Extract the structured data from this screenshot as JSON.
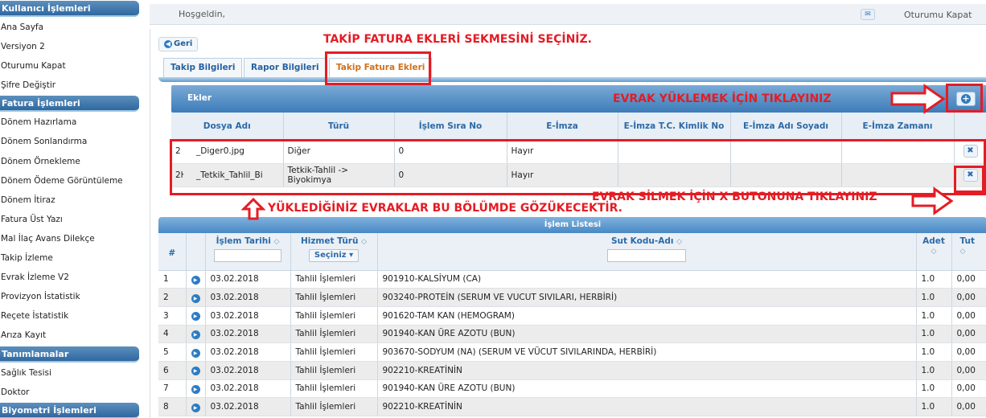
{
  "sidebar": {
    "sections": [
      {
        "title": "Kullanıcı İşlemleri",
        "items": [
          "Ana Sayfa",
          "Versiyon 2",
          "Oturumu Kapat",
          "Şifre Değiştir"
        ]
      },
      {
        "title": "Fatura İşlemleri",
        "items": [
          "Dönem Hazırlama",
          "Dönem Sonlandırma",
          "Dönem Örnekleme",
          "Dönem Ödeme Görüntüleme",
          "Dönem İtiraz",
          "Fatura Üst Yazı",
          "Mal İlaç Avans Dilekçe",
          "Takip İzleme",
          "Evrak İzleme V2",
          "Provizyon İstatistik",
          "Reçete İstatistik",
          "Arıza Kayıt"
        ]
      },
      {
        "title": "Tanımlamalar",
        "items": [
          "Sağlık Tesisi",
          "Doktor"
        ]
      },
      {
        "title": "Biyometri İşlemleri",
        "items": []
      }
    ]
  },
  "topbar": {
    "welcome": "Hoşgeldin,",
    "logout": "Oturumu Kapat",
    "mail_icon": "mail-icon"
  },
  "back_button": "Geri",
  "tabs": [
    "Takip Bilgileri",
    "Rapor Bilgileri",
    "Takip Fatura Ekleri"
  ],
  "attachments": {
    "title": "Ekler",
    "columns": [
      "Dosya Adı",
      "Türü",
      "İşlem Sıra No",
      "E-İmza",
      "E-İmza T.C. Kimlik No",
      "E-İmza Adı Soyadı",
      "E-İmza Zamanı"
    ],
    "rows": [
      {
        "id": "2",
        "file": "_Diger0.jpg",
        "type": "Diğer",
        "seq": "0",
        "esign": "Hayır"
      },
      {
        "id": "2ŀ",
        "file": "_Tetkik_Tahlil_Bi",
        "type": "Tetkik-Tahlil -> Biyokimya",
        "seq": "0",
        "esign": "Hayır"
      }
    ]
  },
  "process_list": {
    "title": "İşlem Listesi",
    "columns": {
      "num": "#",
      "date": "İşlem Tarihi",
      "service": "Hizmet Türü",
      "code": "Sut Kodu-Adı",
      "qty": "Adet",
      "total": "Tut"
    },
    "service_select": "Seçiniz",
    "rows": [
      {
        "n": "1",
        "date": "03.02.2018",
        "service": "Tahlil İşlemleri",
        "code": "901910-KALSİYUM (CA)",
        "qty": "1.0",
        "total": "0,00"
      },
      {
        "n": "2",
        "date": "03.02.2018",
        "service": "Tahlil İşlemleri",
        "code": "903240-PROTEİN (SERUM VE VUCUT SIVILARI, HERBİRİ)",
        "qty": "1.0",
        "total": "0,00"
      },
      {
        "n": "3",
        "date": "03.02.2018",
        "service": "Tahlil İşlemleri",
        "code": "901620-TAM KAN (HEMOGRAM)",
        "qty": "1.0",
        "total": "0,00"
      },
      {
        "n": "4",
        "date": "03.02.2018",
        "service": "Tahlil İşlemleri",
        "code": "901940-KAN ÜRE AZOTU (BUN)",
        "qty": "1.0",
        "total": "0,00"
      },
      {
        "n": "5",
        "date": "03.02.2018",
        "service": "Tahlil İşlemleri",
        "code": "903670-SODYUM (NA) (SERUM VE VÜCUT SIVILARINDA, HERBİRİ)",
        "qty": "1.0",
        "total": "0,00"
      },
      {
        "n": "6",
        "date": "03.02.2018",
        "service": "Tahlil İşlemleri",
        "code": "902210-KREATİNİN",
        "qty": "1.0",
        "total": "0,00"
      },
      {
        "n": "7",
        "date": "03.02.2018",
        "service": "Tahlil İşlemleri",
        "code": "901940-KAN ÜRE AZOTU (BUN)",
        "qty": "1.0",
        "total": "0,00"
      },
      {
        "n": "8",
        "date": "03.02.2018",
        "service": "Tahlil İşlemleri",
        "code": "902210-KREATİNİN",
        "qty": "1.0",
        "total": "0,00"
      }
    ]
  },
  "annotations": {
    "select_tab": "TAKİP FATURA EKLERİ SEKMESİNİ SEÇİNİZ.",
    "upload": "EVRAK YÜKLEMEK İÇİN TIKLAYINIZ",
    "delete": "EVRAK SİLMEK İÇİN X BUTONUNA TIKLAYINIZ",
    "listing": "YÜKLEDİĞİNİZ EVRAKLAR BU BÖLÜMDE GÖZÜKECEKTİR.",
    "color": "#e41c24"
  }
}
